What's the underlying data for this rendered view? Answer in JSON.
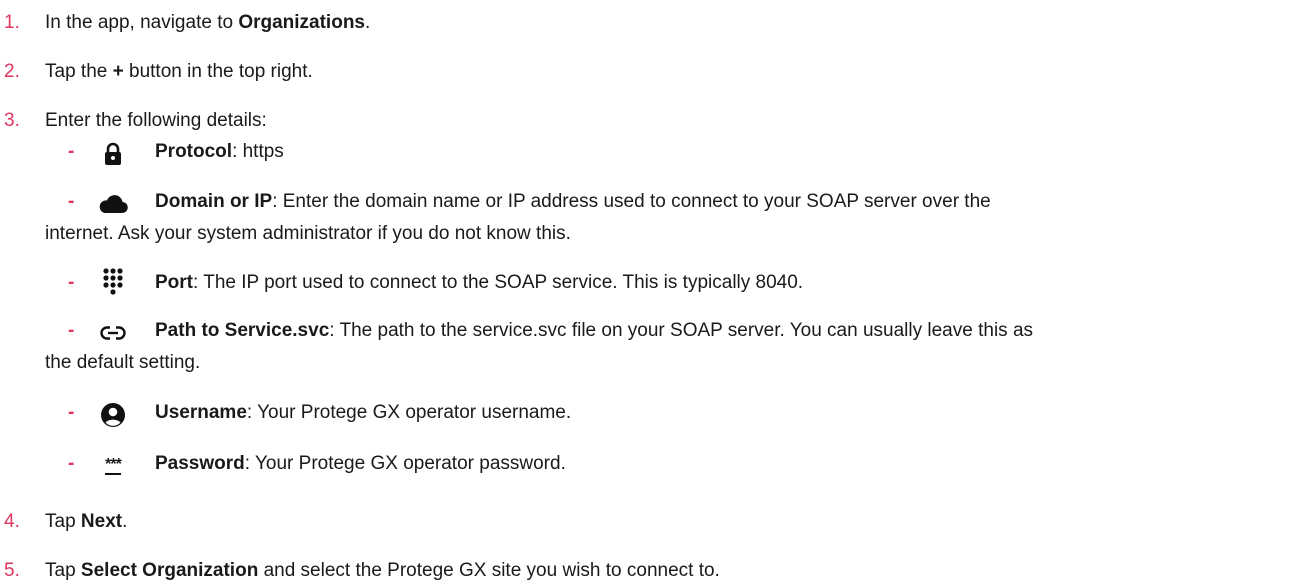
{
  "steps": [
    {
      "num": "1.",
      "pre": "In the app, navigate to ",
      "bold": "Organizations",
      "post": "."
    },
    {
      "num": "2.",
      "pre": "Tap the ",
      "bold": "+",
      "post": " button in the top right."
    },
    {
      "num": "3.",
      "pre": "Enter the following details:",
      "bold": "",
      "post": ""
    },
    {
      "num": "4.",
      "pre": "Tap ",
      "bold": "Next",
      "post": "."
    },
    {
      "num": "5.",
      "pre": "Tap ",
      "bold": "Select Organization",
      "post": " and select the Protege GX site you wish to connect to."
    }
  ],
  "details": [
    {
      "icon": "lock-icon",
      "bold": "Protocol",
      "text": ": https",
      "cont": ""
    },
    {
      "icon": "cloud-icon",
      "bold": "Domain or IP",
      "text": ": Enter the domain name or IP address used to connect to your SOAP server over the",
      "cont": "internet. Ask your system administrator if you do not know this."
    },
    {
      "icon": "dialpad-icon",
      "bold": "Port",
      "text": ": The IP port used to connect to the SOAP service. This is typically 8040.",
      "cont": ""
    },
    {
      "icon": "link-icon",
      "bold": "Path to Service.svc",
      "text": ": The path to the service.svc file on your SOAP server. You can usually leave this as",
      "cont": "the default setting."
    },
    {
      "icon": "user-icon",
      "bold": "Username",
      "text": ": Your Protege GX operator username.",
      "cont": ""
    },
    {
      "icon": "password-icon",
      "bold": "Password",
      "text": ": Your Protege GX operator password.",
      "cont": ""
    }
  ],
  "dash": "-",
  "password_icon_glyph": "***"
}
